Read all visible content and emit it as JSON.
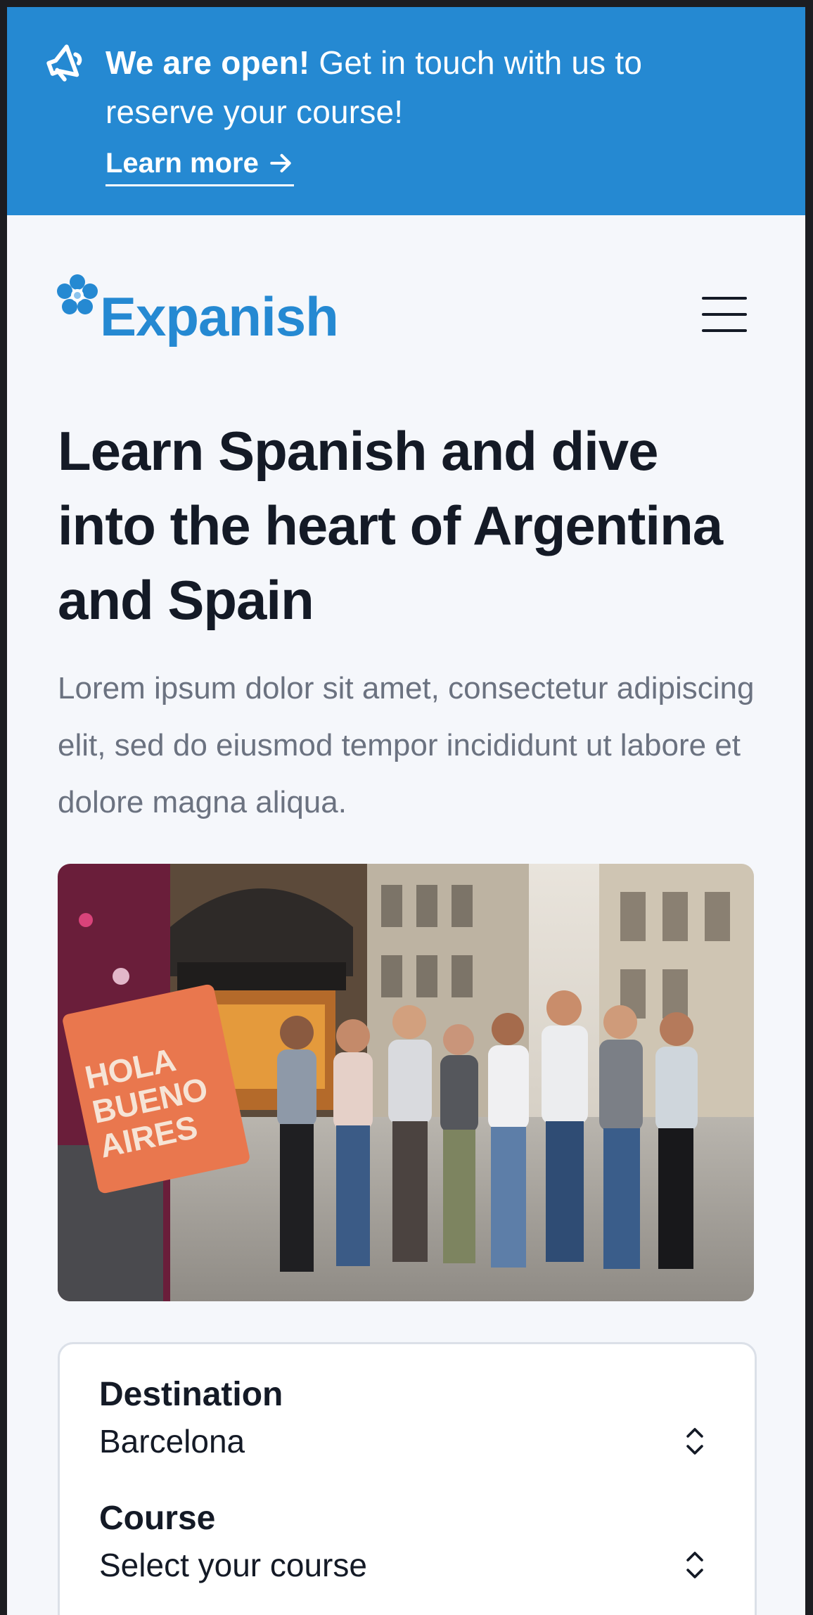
{
  "banner": {
    "headline": "We are open!",
    "message": "Get in touch with us to reserve your course!",
    "link_label": "Learn more",
    "icon": "megaphone-icon",
    "background": "#2589d2"
  },
  "header": {
    "brand": "Expanish",
    "brand_color": "#2589d2",
    "menu_icon": "hamburger-menu-icon"
  },
  "hero": {
    "title": "Learn Spanish and dive into the heart of Argentina and Spain",
    "text": "Lorem ipsum dolor sit amet, consectetur adipiscing elit, sed do eiusmod tempor incididunt ut labore et dolore magna aliqua.",
    "image_alt": "Group of students posing on a street in Buenos Aires"
  },
  "booking": {
    "destination_label": "Destination",
    "destination_value": "Barcelona",
    "course_label": "Course",
    "course_placeholder": "Select your course"
  }
}
